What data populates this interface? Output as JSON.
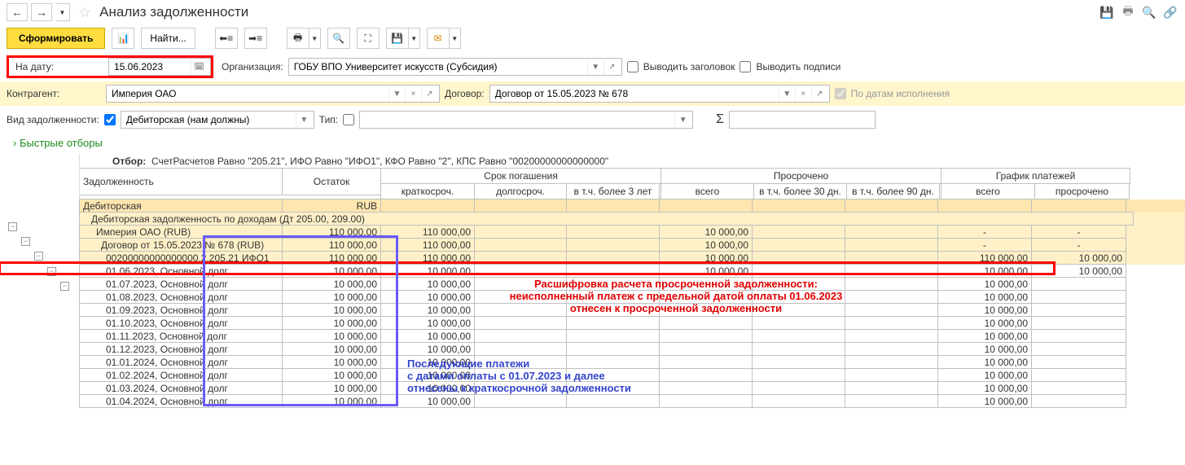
{
  "header": {
    "title": "Анализ задолженности"
  },
  "toolbar": {
    "form_btn": "Сформировать",
    "find_btn": "Найти..."
  },
  "filters": {
    "date_label": "На дату:",
    "date_value": "15.06.2023",
    "org_label": "Организация:",
    "org_value": "ГОБУ ВПО Университет искусств (Субсидия)",
    "show_header": "Выводить заголовок",
    "show_sign": "Выводить подписи",
    "contragent_label": "Контрагент:",
    "contragent_value": "Империя ОАО",
    "contract_label": "Договор:",
    "contract_value": "Договор от 15.05.2023 № 678",
    "by_exec_dates": "По датам исполнения",
    "debt_kind_label": "Вид задолженности:",
    "debt_kind_value": "Дебиторская (нам должны)",
    "type_label": "Тип:",
    "sigma": "Σ",
    "quick": "Быстрые отборы"
  },
  "report": {
    "filter_label": "Отбор:",
    "filter_text": "СчетРасчетов Равно \"205.21\", ИФО Равно \"ИФО1\", КФО Равно \"2\", КПС Равно \"00200000000000000\"",
    "cols": {
      "name": "Задолженность",
      "ost": "Остаток",
      "srok": "Срок погашения",
      "kr": "краткосроч.",
      "dl": "долгосроч.",
      "l3": "в т.ч. более 3 лет",
      "prosr": "Просрочено",
      "vs": "всего",
      "d30": "в т.ч. более 30 дн.",
      "d90": "в т.ч. более 90 дн.",
      "graf": "График платежей",
      "gv": "всего",
      "gp": "просрочено"
    },
    "rows": [
      {
        "name": "Дебиторская",
        "ost": "RUB",
        "cls": "bg-beige2",
        "pad": 0
      },
      {
        "name": "Дебиторская задолженность по доходам (Дт 205.00, 209.00)",
        "cls": "bg-beige",
        "pad": 14,
        "span": true
      },
      {
        "name": "Империя ОАО (RUB)",
        "ost": "110 000,00",
        "kr": "110 000,00",
        "vs": "10 000,00",
        "gv": "-",
        "gp": "-",
        "cls": "bg-beige",
        "pad": 20
      },
      {
        "name": "Договор от 15.05.2023 № 678 (RUB)",
        "ost": "110 000,00",
        "kr": "110 000,00",
        "vs": "10 000,00",
        "gv": "-",
        "gp": "-",
        "cls": "bg-beige",
        "pad": 26
      },
      {
        "name": "00200000000000000.2.205.21 ИФО1",
        "ost": "110 000,00",
        "kr": "110 000,00",
        "vs": "10 000,00",
        "gv": "110 000,00",
        "gp": "10 000,00",
        "cls": "bg-beige",
        "pad": 32
      },
      {
        "name": "01.06.2023, Основной долг",
        "ost": "10 000,00",
        "kr": "10 000,00",
        "vs": "10 000,00",
        "gv": "10 000,00",
        "gp": "10 000,00",
        "pad": 32
      },
      {
        "name": "01.07.2023, Основной долг",
        "ost": "10 000,00",
        "kr": "10 000,00",
        "gv": "10 000,00",
        "pad": 32
      },
      {
        "name": "01.08.2023, Основной долг",
        "ost": "10 000,00",
        "kr": "10 000,00",
        "gv": "10 000,00",
        "pad": 32
      },
      {
        "name": "01.09.2023, Основной долг",
        "ost": "10 000,00",
        "kr": "10 000,00",
        "gv": "10 000,00",
        "pad": 32
      },
      {
        "name": "01.10.2023, Основной долг",
        "ost": "10 000,00",
        "kr": "10 000,00",
        "gv": "10 000,00",
        "pad": 32
      },
      {
        "name": "01.11.2023, Основной долг",
        "ost": "10 000,00",
        "kr": "10 000,00",
        "gv": "10 000,00",
        "pad": 32
      },
      {
        "name": "01.12.2023, Основной долг",
        "ost": "10 000,00",
        "kr": "10 000,00",
        "gv": "10 000,00",
        "pad": 32
      },
      {
        "name": "01.01.2024, Основной долг",
        "ost": "10 000,00",
        "kr": "10 000,00",
        "gv": "10 000,00",
        "pad": 32
      },
      {
        "name": "01.02.2024, Основной долг",
        "ost": "10 000,00",
        "kr": "10 000,00",
        "gv": "10 000,00",
        "pad": 32
      },
      {
        "name": "01.03.2024, Основной долг",
        "ost": "10 000,00",
        "kr": "10 000,00",
        "gv": "10 000,00",
        "pad": 32
      },
      {
        "name": "01.04.2024, Основной долг",
        "ost": "10 000,00",
        "kr": "10 000,00",
        "gv": "10 000,00",
        "pad": 32
      }
    ]
  },
  "notes": {
    "red1": "Расшифровка расчета просроченной задолженности:",
    "red2": "неисполненный платеж с предельной датой оплаты 01.06.2023",
    "red3": "отнесен к просроченной задолженности",
    "blue1": "Последующие платежи",
    "blue2": "с датами оплаты с 01.07.2023 и далее",
    "blue3": "отнесены к краткосрочной задолженности"
  }
}
